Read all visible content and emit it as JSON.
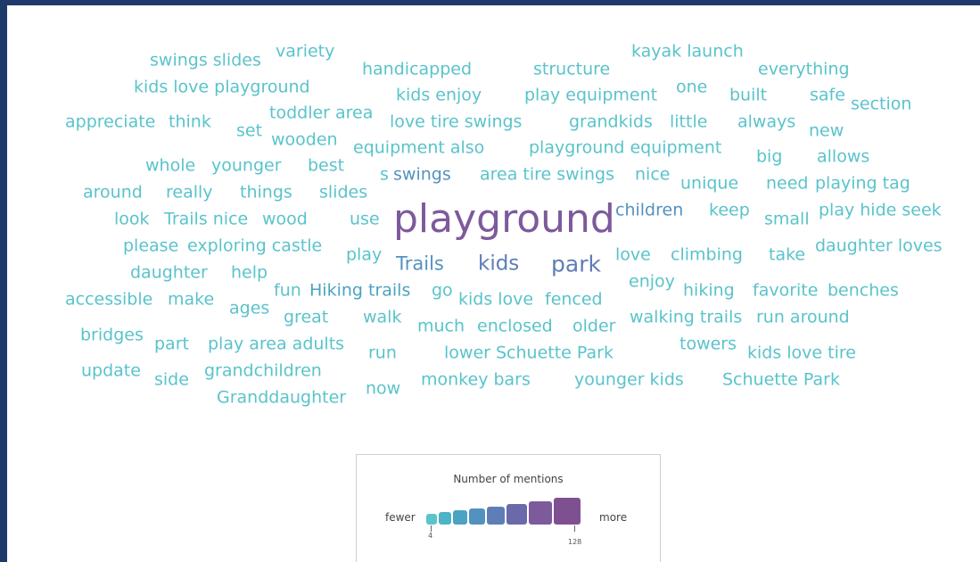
{
  "chart_data": {
    "type": "wordcloud",
    "words": [
      {
        "text": "playground",
        "mentions": 128
      },
      {
        "text": "park",
        "mentions": 40
      },
      {
        "text": "kids",
        "mentions": 36
      },
      {
        "text": "Trails",
        "mentions": 28
      },
      {
        "text": "swings",
        "mentions": 24
      },
      {
        "text": "children",
        "mentions": 20
      },
      {
        "text": "Hiking trails",
        "mentions": 14
      },
      {
        "text": "swings slides",
        "mentions": 4
      },
      {
        "text": "variety",
        "mentions": 4
      },
      {
        "text": "handicapped",
        "mentions": 4
      },
      {
        "text": "structure",
        "mentions": 4
      },
      {
        "text": "kayak launch",
        "mentions": 4
      },
      {
        "text": "everything",
        "mentions": 4
      },
      {
        "text": "kids love playground",
        "mentions": 4
      },
      {
        "text": "kids enjoy",
        "mentions": 4
      },
      {
        "text": "play equipment",
        "mentions": 4
      },
      {
        "text": "one",
        "mentions": 4
      },
      {
        "text": "built",
        "mentions": 4
      },
      {
        "text": "safe",
        "mentions": 4
      },
      {
        "text": "section",
        "mentions": 4
      },
      {
        "text": "appreciate",
        "mentions": 4
      },
      {
        "text": "think",
        "mentions": 4
      },
      {
        "text": "toddler area",
        "mentions": 4
      },
      {
        "text": "set",
        "mentions": 4
      },
      {
        "text": "love tire swings",
        "mentions": 4
      },
      {
        "text": "grandkids",
        "mentions": 4
      },
      {
        "text": "little",
        "mentions": 4
      },
      {
        "text": "always",
        "mentions": 4
      },
      {
        "text": "new",
        "mentions": 4
      },
      {
        "text": "wooden",
        "mentions": 4
      },
      {
        "text": "equipment also",
        "mentions": 4
      },
      {
        "text": "playground equipment",
        "mentions": 4
      },
      {
        "text": "whole",
        "mentions": 4
      },
      {
        "text": "younger",
        "mentions": 4
      },
      {
        "text": "best",
        "mentions": 4
      },
      {
        "text": "big",
        "mentions": 4
      },
      {
        "text": "allows",
        "mentions": 4
      },
      {
        "text": "s",
        "mentions": 4
      },
      {
        "text": "area tire swings",
        "mentions": 4
      },
      {
        "text": "nice",
        "mentions": 4
      },
      {
        "text": "around",
        "mentions": 4
      },
      {
        "text": "really",
        "mentions": 4
      },
      {
        "text": "things",
        "mentions": 4
      },
      {
        "text": "slides",
        "mentions": 4
      },
      {
        "text": "unique",
        "mentions": 4
      },
      {
        "text": "need",
        "mentions": 4
      },
      {
        "text": "playing tag",
        "mentions": 4
      },
      {
        "text": "look",
        "mentions": 4
      },
      {
        "text": "Trails nice",
        "mentions": 4
      },
      {
        "text": "wood",
        "mentions": 4
      },
      {
        "text": "use",
        "mentions": 4
      },
      {
        "text": "keep",
        "mentions": 4
      },
      {
        "text": "small",
        "mentions": 4
      },
      {
        "text": "play hide seek",
        "mentions": 4
      },
      {
        "text": "please",
        "mentions": 4
      },
      {
        "text": "exploring castle",
        "mentions": 4
      },
      {
        "text": "daughter loves",
        "mentions": 4
      },
      {
        "text": "daughter",
        "mentions": 4
      },
      {
        "text": "help",
        "mentions": 4
      },
      {
        "text": "play",
        "mentions": 4
      },
      {
        "text": "love",
        "mentions": 4
      },
      {
        "text": "climbing",
        "mentions": 4
      },
      {
        "text": "take",
        "mentions": 4
      },
      {
        "text": "accessible",
        "mentions": 4
      },
      {
        "text": "make",
        "mentions": 4
      },
      {
        "text": "fun",
        "mentions": 4
      },
      {
        "text": "go",
        "mentions": 4
      },
      {
        "text": "enjoy",
        "mentions": 4
      },
      {
        "text": "hiking",
        "mentions": 4
      },
      {
        "text": "favorite",
        "mentions": 4
      },
      {
        "text": "benches",
        "mentions": 4
      },
      {
        "text": "ages",
        "mentions": 4
      },
      {
        "text": "kids love",
        "mentions": 4
      },
      {
        "text": "fenced",
        "mentions": 4
      },
      {
        "text": "great",
        "mentions": 4
      },
      {
        "text": "walk",
        "mentions": 4
      },
      {
        "text": "much",
        "mentions": 4
      },
      {
        "text": "enclosed",
        "mentions": 4
      },
      {
        "text": "older",
        "mentions": 4
      },
      {
        "text": "walking trails",
        "mentions": 4
      },
      {
        "text": "run around",
        "mentions": 4
      },
      {
        "text": "bridges",
        "mentions": 4
      },
      {
        "text": "part",
        "mentions": 4
      },
      {
        "text": "play area adults",
        "mentions": 4
      },
      {
        "text": "towers",
        "mentions": 4
      },
      {
        "text": "kids love tire",
        "mentions": 4
      },
      {
        "text": "run",
        "mentions": 4
      },
      {
        "text": "lower Schuette Park",
        "mentions": 4
      },
      {
        "text": "update",
        "mentions": 4
      },
      {
        "text": "side",
        "mentions": 4
      },
      {
        "text": "grandchildren",
        "mentions": 4
      },
      {
        "text": "monkey bars",
        "mentions": 4
      },
      {
        "text": "younger kids",
        "mentions": 4
      },
      {
        "text": "Schuette Park",
        "mentions": 4
      },
      {
        "text": "Granddaughter",
        "mentions": 4
      },
      {
        "text": "now",
        "mentions": 4
      }
    ],
    "legend": {
      "title": "Number of mentions",
      "low_label": "fewer",
      "high_label": "more",
      "min_value": "4",
      "max_value": "128",
      "colors": [
        "#5ac3cb",
        "#4db3c7",
        "#4aa3c2",
        "#5392bf",
        "#5d7eb7",
        "#6a6aaa",
        "#7d5a9c",
        "#7f5090"
      ]
    }
  }
}
